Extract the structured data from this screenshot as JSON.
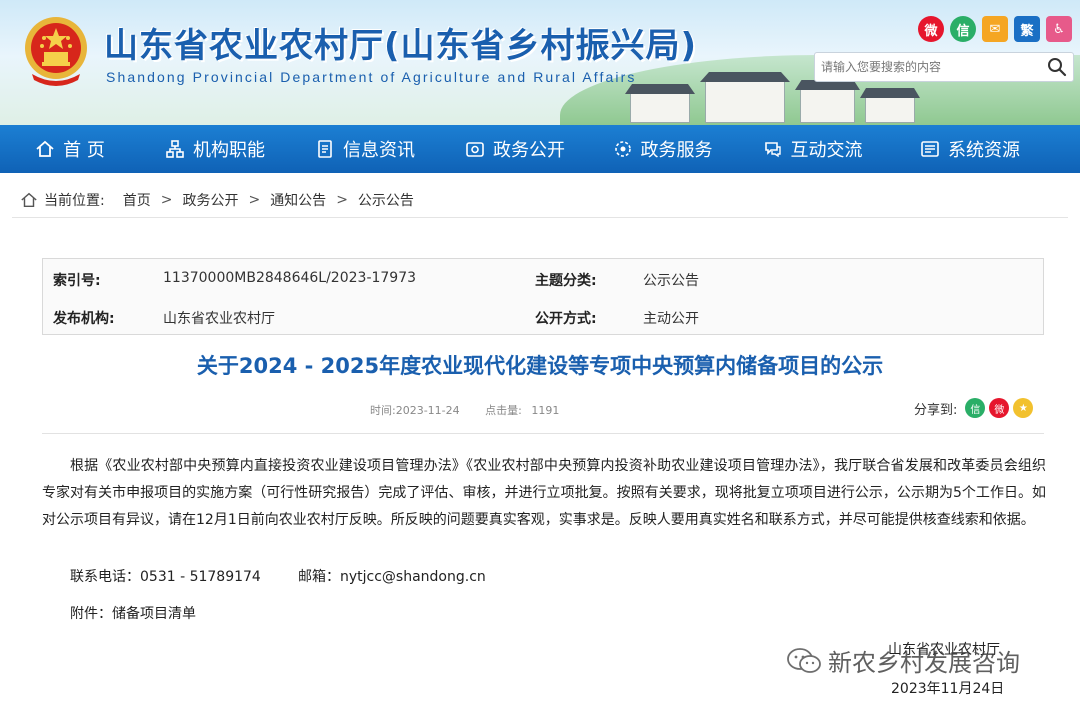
{
  "header": {
    "title": "山东省农业农村厅(山东省乡村振兴局)",
    "subtitle": "Shandong Provincial Department of Agriculture and Rural Affairs",
    "search_placeholder": "请输入您要搜索的内容",
    "top_icons": [
      {
        "name": "weibo-icon",
        "glyph": "微",
        "color": "#e6162d"
      },
      {
        "name": "wechat-icon",
        "glyph": "信",
        "color": "#2aae67"
      },
      {
        "name": "mail-icon",
        "glyph": "✉",
        "color": "#f5a623"
      },
      {
        "name": "traditional-chinese-toggle",
        "glyph": "繁",
        "color": "#1a6fc4"
      },
      {
        "name": "accessibility-icon",
        "glyph": "♿",
        "color": "#e75a8a"
      }
    ]
  },
  "nav": {
    "items": [
      {
        "label": "首 页",
        "icon": "home-icon"
      },
      {
        "label": "机构职能",
        "icon": "org-icon"
      },
      {
        "label": "信息资讯",
        "icon": "document-icon"
      },
      {
        "label": "政务公开",
        "icon": "open-icon"
      },
      {
        "label": "政务服务",
        "icon": "service-icon"
      },
      {
        "label": "互动交流",
        "icon": "chat-icon"
      },
      {
        "label": "系统资源",
        "icon": "system-icon"
      }
    ]
  },
  "breadcrumb": {
    "label": "当前位置:",
    "items": [
      "首页",
      "政务公开",
      "通知公告",
      "公示公告"
    ],
    "separator": ">"
  },
  "meta": {
    "index_label": "索引号:",
    "index_value": "11370000MB2848646L/2023-17973",
    "topic_label": "主题分类:",
    "topic_value": "公示公告",
    "publisher_label": "发布机构:",
    "publisher_value": "山东省农业农村厅",
    "method_label": "公开方式:",
    "method_value": "主动公开"
  },
  "article": {
    "title": "关于2024 - 2025年度农业现代化建设等专项中央预算内储备项目的公示",
    "time": "时间:2023-11-24",
    "clicks_label": "点击量:",
    "clicks": "1191",
    "share_label": "分享到:",
    "body": "根据《农业农村部中央预算内直接投资农业建设项目管理办法》《农业农村部中央预算内投资补助农业建设项目管理办法》，我厅联合省发展和改革委员会组织专家对有关市申报项目的实施方案（可行性研究报告）完成了评估、审核，并进行立项批复。按照有关要求，现将批复立项项目进行公示，公示期为5个工作日。如对公示项目有异议，请在12月1日前向农业农村厅反映。所反映的问题要真实客观，实事求是。反映人要用真实姓名和联系方式，并尽可能提供核查线索和依据。",
    "contact_phone": "联系电话：0531 - 51789174",
    "contact_email": "邮箱：nytjcc@shandong.cn",
    "attachment_label": "附件：",
    "attachment_link": "储备项目清单",
    "signature": "山东省农业农村厅",
    "date": "2023年11月24日"
  },
  "watermark": {
    "text": "新农乡村发展咨询"
  },
  "colors": {
    "brand_blue": "#1a5fae",
    "nav_blue": "#1270c4"
  }
}
